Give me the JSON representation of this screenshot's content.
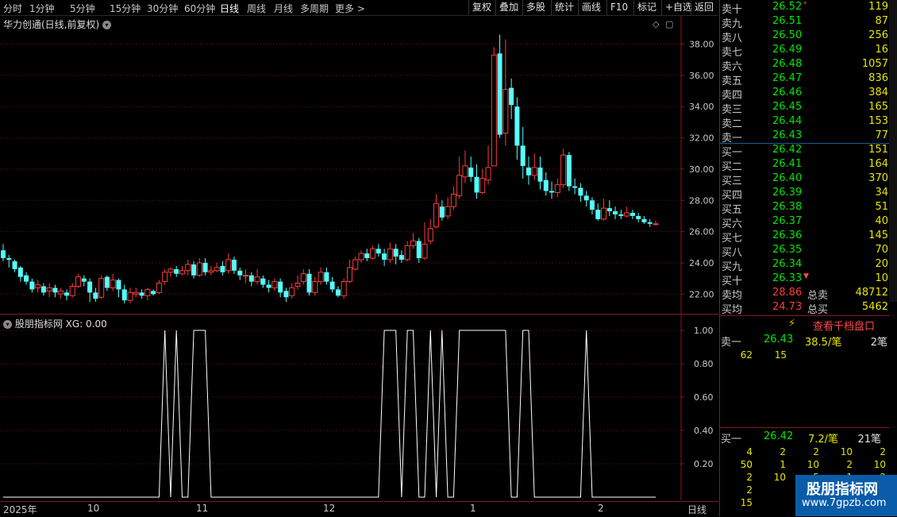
{
  "toolbar": {
    "periods": [
      "分时",
      "1分钟",
      "5分钟",
      "15分钟",
      "30分钟",
      "60分钟",
      "日线",
      "周线",
      "月线",
      "多周期",
      "更多"
    ],
    "active_period": "日线",
    "right_buttons": [
      "复权",
      "叠加",
      "多股",
      "统计",
      "画线",
      "F10",
      "标记",
      "+自选",
      "返回"
    ]
  },
  "stock": {
    "title": "华力创通(日线,前复权)"
  },
  "indicator": {
    "title": "股朋指标网 XG: 0.00",
    "y_ticks": [
      "1.00",
      "0.80",
      "0.60",
      "0.40",
      "0.20"
    ]
  },
  "main_axis": {
    "y_ticks": [
      "38.00",
      "36.00",
      "34.00",
      "32.00",
      "30.00",
      "28.00",
      "26.00",
      "24.00",
      "22.00"
    ]
  },
  "date_axis": {
    "ticks": [
      "2025年",
      "10",
      "11",
      "12",
      "1",
      "2"
    ],
    "label": "日线"
  },
  "order_book": {
    "asks": [
      {
        "label": "卖十",
        "price": "26.52",
        "vol": "119",
        "mark": "*"
      },
      {
        "label": "卖九",
        "price": "26.51",
        "vol": "87"
      },
      {
        "label": "卖八",
        "price": "26.50",
        "vol": "256"
      },
      {
        "label": "卖七",
        "price": "26.49",
        "vol": "16"
      },
      {
        "label": "卖六",
        "price": "26.48",
        "vol": "1057"
      },
      {
        "label": "卖五",
        "price": "26.47",
        "vol": "836"
      },
      {
        "label": "卖四",
        "price": "26.46",
        "vol": "384"
      },
      {
        "label": "卖三",
        "price": "26.45",
        "vol": "165"
      },
      {
        "label": "卖二",
        "price": "26.44",
        "vol": "153"
      },
      {
        "label": "卖一",
        "price": "26.43",
        "vol": "77"
      }
    ],
    "bids": [
      {
        "label": "买一",
        "price": "26.42",
        "vol": "151"
      },
      {
        "label": "买二",
        "price": "26.41",
        "vol": "164"
      },
      {
        "label": "买三",
        "price": "26.40",
        "vol": "370"
      },
      {
        "label": "买四",
        "price": "26.39",
        "vol": "34"
      },
      {
        "label": "买五",
        "price": "26.38",
        "vol": "51"
      },
      {
        "label": "买六",
        "price": "26.37",
        "vol": "40"
      },
      {
        "label": "买七",
        "price": "26.36",
        "vol": "145"
      },
      {
        "label": "买八",
        "price": "26.35",
        "vol": "70"
      },
      {
        "label": "买九",
        "price": "26.34",
        "vol": "20"
      },
      {
        "label": "买十",
        "price": "26.33",
        "vol": "10",
        "mark": "▼"
      }
    ],
    "sell_avg_label": "卖均",
    "sell_avg": "28.86",
    "total_sell_label": "总卖",
    "total_sell": "48712",
    "buy_avg_label": "买均",
    "buy_avg": "24.73",
    "total_buy_label": "总买",
    "total_buy": "5462"
  },
  "level2": {
    "button": "查看千档盘口",
    "ask1_label": "卖一",
    "ask1_price": "26.43",
    "ask1_avg": "38.5/笔",
    "ask1_count": "2笔",
    "ask1_orders": [
      "62",
      "15"
    ],
    "bid1_label": "买一",
    "bid1_price": "26.42",
    "bid1_avg": "7.2/笔",
    "bid1_count": "21笔",
    "bid1_orders": [
      [
        "4",
        "2",
        "2",
        "10",
        "2"
      ],
      [
        "50",
        "1",
        "10",
        "2",
        "10"
      ],
      [
        "2",
        "10",
        "5",
        "1",
        "2"
      ],
      [
        "2",
        "",
        "",
        "",
        ""
      ],
      [
        "15",
        "",
        "",
        "",
        ""
      ]
    ]
  },
  "watermark": {
    "title": "股朋指标网",
    "url": "www.7gpzb.com"
  },
  "colors": {
    "up": "#ff3b3b",
    "down": "#54ffff",
    "grid": "#7a1010",
    "ask_price": "#00e600"
  },
  "chart_data": [
    {
      "type": "candlestick",
      "title": "华力创通(日线,前复权)",
      "ylim": [
        21.0,
        39.5
      ],
      "y_ticks": [
        22,
        24,
        26,
        28,
        30,
        32,
        34,
        36,
        38
      ],
      "x_ticks": [
        "2025年",
        "10",
        "11",
        "12",
        "1",
        "2"
      ],
      "candles": [
        [
          24.8,
          24.3,
          25.2,
          24.1
        ],
        [
          24.3,
          24.2,
          24.5,
          23.7
        ],
        [
          24.1,
          23.6,
          24.2,
          23.4
        ],
        [
          23.7,
          23.1,
          23.8,
          22.8
        ],
        [
          23.2,
          22.8,
          23.4,
          22.6
        ],
        [
          22.8,
          22.3,
          23.0,
          22.1
        ],
        [
          22.4,
          22.6,
          22.9,
          22.1
        ],
        [
          22.5,
          22.1,
          22.7,
          21.9
        ],
        [
          22.2,
          22.4,
          22.7,
          21.8
        ],
        [
          22.4,
          22.1,
          22.6,
          21.8
        ],
        [
          22.0,
          22.2,
          22.4,
          21.7
        ],
        [
          22.1,
          21.9,
          22.3,
          21.6
        ],
        [
          21.9,
          22.5,
          22.7,
          21.8
        ],
        [
          22.5,
          23.1,
          23.3,
          22.4
        ],
        [
          23.0,
          22.8,
          23.2,
          22.5
        ],
        [
          22.8,
          22.1,
          23.0,
          21.5
        ],
        [
          22.1,
          21.7,
          22.4,
          21.5
        ],
        [
          21.8,
          23.0,
          23.2,
          21.7
        ],
        [
          23.1,
          22.4,
          23.2,
          22.2
        ],
        [
          22.4,
          22.9,
          23.3,
          22.2
        ],
        [
          22.9,
          22.3,
          23.0,
          21.8
        ],
        [
          22.3,
          21.6,
          22.6,
          21.4
        ],
        [
          21.6,
          22.1,
          22.4,
          21.4
        ],
        [
          22.0,
          22.1,
          22.4,
          21.8
        ],
        [
          22.1,
          21.9,
          22.3,
          21.7
        ],
        [
          21.9,
          22.3,
          22.4,
          21.6
        ],
        [
          22.2,
          22.0,
          22.3,
          21.9
        ],
        [
          22.1,
          22.7,
          22.9,
          22.0
        ],
        [
          22.8,
          23.4,
          23.6,
          22.6
        ],
        [
          23.4,
          23.6,
          23.7,
          23.1
        ],
        [
          23.6,
          23.3,
          23.8,
          23.1
        ],
        [
          23.3,
          23.5,
          23.8,
          23.2
        ],
        [
          23.5,
          23.9,
          24.2,
          23.2
        ],
        [
          23.9,
          23.2,
          24.1,
          23.0
        ],
        [
          23.2,
          24.0,
          24.3,
          23.1
        ],
        [
          24.0,
          23.4,
          24.3,
          23.2
        ],
        [
          23.4,
          23.5,
          23.8,
          23.2
        ],
        [
          23.5,
          23.7,
          24.0,
          23.4
        ],
        [
          23.8,
          23.4,
          24.1,
          23.2
        ],
        [
          23.5,
          24.2,
          24.6,
          23.3
        ],
        [
          24.2,
          23.5,
          24.4,
          23.3
        ],
        [
          23.5,
          23.2,
          23.7,
          22.9
        ],
        [
          23.2,
          23.2,
          23.6,
          22.7
        ],
        [
          23.2,
          22.8,
          23.4,
          22.5
        ],
        [
          22.8,
          23.1,
          23.6,
          22.6
        ],
        [
          23.0,
          22.6,
          23.2,
          22.4
        ],
        [
          22.6,
          22.4,
          22.9,
          22.1
        ],
        [
          22.4,
          22.8,
          23.0,
          22.2
        ],
        [
          22.8,
          22.1,
          23.0,
          21.8
        ],
        [
          22.2,
          21.8,
          22.4,
          21.5
        ],
        [
          21.9,
          22.4,
          22.7,
          21.7
        ],
        [
          22.5,
          22.7,
          23.2,
          22.3
        ],
        [
          22.8,
          23.3,
          23.6,
          22.6
        ],
        [
          23.3,
          22.1,
          23.6,
          21.9
        ],
        [
          22.1,
          22.8,
          23.1,
          21.9
        ],
        [
          22.8,
          23.4,
          23.7,
          22.6
        ],
        [
          23.4,
          22.8,
          23.7,
          22.6
        ],
        [
          22.8,
          22.3,
          23.1,
          22.1
        ],
        [
          22.3,
          21.9,
          22.5,
          21.8
        ],
        [
          21.9,
          22.8,
          23.0,
          21.7
        ],
        [
          22.8,
          23.7,
          24.2,
          22.7
        ],
        [
          23.6,
          24.2,
          24.4,
          23.5
        ],
        [
          24.2,
          24.6,
          24.8,
          24.0
        ],
        [
          24.6,
          24.3,
          24.9,
          24.1
        ],
        [
          24.3,
          24.9,
          25.1,
          24.2
        ],
        [
          24.9,
          24.6,
          25.2,
          24.4
        ],
        [
          24.6,
          24.2,
          24.9,
          23.8
        ],
        [
          24.2,
          24.9,
          25.3,
          24.0
        ],
        [
          24.9,
          24.4,
          25.2,
          23.9
        ],
        [
          24.5,
          24.2,
          24.8,
          24.0
        ],
        [
          24.2,
          25.1,
          25.4,
          24.1
        ],
        [
          25.1,
          25.4,
          25.9,
          24.9
        ],
        [
          25.4,
          24.3,
          25.6,
          24.0
        ],
        [
          24.3,
          25.2,
          26.6,
          24.2
        ],
        [
          25.4,
          26.2,
          26.8,
          25.2
        ],
        [
          26.3,
          27.8,
          28.4,
          26.2
        ],
        [
          27.6,
          26.9,
          28.0,
          26.7
        ],
        [
          27.0,
          27.6,
          28.2,
          26.8
        ],
        [
          27.6,
          28.4,
          28.9,
          27.4
        ],
        [
          28.3,
          29.6,
          30.8,
          28.1
        ],
        [
          29.5,
          30.2,
          31.2,
          29.1
        ],
        [
          30.1,
          29.5,
          30.8,
          29.2
        ],
        [
          29.5,
          28.5,
          30.3,
          28.1
        ],
        [
          28.5,
          29.4,
          30.0,
          28.4
        ],
        [
          29.3,
          30.1,
          31.5,
          29.0
        ],
        [
          30.2,
          37.3,
          37.8,
          32.2
        ],
        [
          37.4,
          32.2,
          38.6,
          32.0
        ],
        [
          32.3,
          35.1,
          38.3,
          31.5
        ],
        [
          35.2,
          34.1,
          35.8,
          33.2
        ],
        [
          34.0,
          31.5,
          34.6,
          30.6
        ],
        [
          31.5,
          30.2,
          32.7,
          29.4
        ],
        [
          30.1,
          29.6,
          30.8,
          29.0
        ],
        [
          29.6,
          30.1,
          31.0,
          29.3
        ],
        [
          30.1,
          29.2,
          30.8,
          28.7
        ],
        [
          29.3,
          28.6,
          29.8,
          28.3
        ],
        [
          28.6,
          28.5,
          29.2,
          28.1
        ],
        [
          28.5,
          29.0,
          29.4,
          28.2
        ],
        [
          29.0,
          30.9,
          31.3,
          28.8
        ],
        [
          30.9,
          28.9,
          31.1,
          28.6
        ],
        [
          28.9,
          28.8,
          29.4,
          28.4
        ],
        [
          28.8,
          28.3,
          29.1,
          27.9
        ],
        [
          28.3,
          28.0,
          28.6,
          27.6
        ],
        [
          28.0,
          27.4,
          28.2,
          27.1
        ],
        [
          27.4,
          26.8,
          27.8,
          26.7
        ],
        [
          26.8,
          27.5,
          28.1,
          26.7
        ],
        [
          27.5,
          27.3,
          28.0,
          27.0
        ],
        [
          27.3,
          27.1,
          27.6,
          26.8
        ],
        [
          27.1,
          27.0,
          27.4,
          26.8
        ],
        [
          27.0,
          27.2,
          27.6,
          26.9
        ],
        [
          27.2,
          27.0,
          27.4,
          26.8
        ],
        [
          27.0,
          26.8,
          27.2,
          26.6
        ],
        [
          26.8,
          26.6,
          27.0,
          26.5
        ],
        [
          26.6,
          26.5,
          26.8,
          26.3
        ],
        [
          26.5,
          26.5,
          26.7,
          26.4
        ]
      ]
    },
    {
      "type": "line",
      "title": "股朋指标网 XG: 0.00",
      "ylim": [
        0,
        1
      ],
      "y_ticks": [
        0.2,
        0.4,
        0.6,
        0.8,
        1.0
      ],
      "series": [
        {
          "name": "XG",
          "values": [
            0,
            0,
            0,
            0,
            0,
            0,
            0,
            0,
            0,
            0,
            0,
            0,
            0,
            0,
            0,
            0,
            0,
            0,
            0,
            0,
            0,
            0,
            0,
            0,
            0,
            0,
            0,
            0,
            1,
            0,
            1,
            0,
            0,
            1,
            1,
            1,
            0,
            0,
            0,
            0,
            0,
            0,
            0,
            0,
            0,
            0,
            0,
            0,
            0,
            0,
            0,
            0,
            0,
            0,
            0,
            0,
            0,
            0,
            0,
            0,
            0,
            0,
            0,
            0,
            0,
            0,
            1,
            1,
            1,
            0,
            1,
            1,
            0,
            0,
            1,
            0,
            1,
            0,
            0,
            1,
            1,
            1,
            1,
            1,
            1,
            1,
            1,
            1,
            0,
            0,
            1,
            1,
            0,
            0,
            0,
            0,
            0,
            0,
            0,
            0,
            0,
            1,
            0,
            0,
            0,
            0,
            0,
            0,
            0,
            0,
            0,
            0,
            0,
            0
          ]
        }
      ]
    }
  ]
}
